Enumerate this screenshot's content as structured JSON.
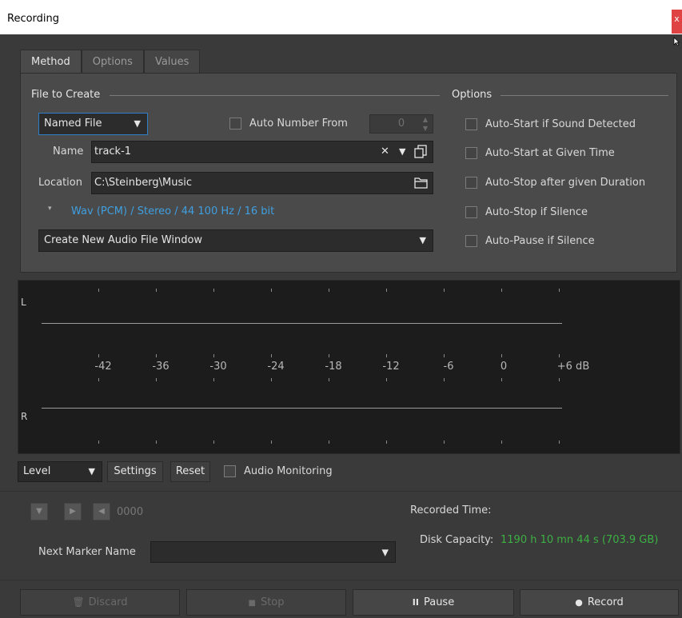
{
  "window": {
    "title": "Recording",
    "close_label": "x"
  },
  "tabs": [
    {
      "label": "Method",
      "active": true
    },
    {
      "label": "Options",
      "active": false
    },
    {
      "label": "Values",
      "active": false
    }
  ],
  "file_to_create": {
    "section_label": "File to Create",
    "mode_dropdown": "Named File",
    "auto_number_label": "Auto Number From",
    "auto_number_value": "0",
    "name_label": "Name",
    "name_value": "track-1",
    "location_label": "Location",
    "location_value": "C:\\Steinberg\\Music",
    "format_text": "Wav (PCM) / Stereo / 44 100 Hz / 16 bit",
    "window_dropdown": "Create New Audio File Window"
  },
  "options": {
    "section_label": "Options",
    "items": [
      "Auto-Start if Sound Detected",
      "Auto-Start at Given Time",
      "Auto-Stop after given Duration",
      "Auto-Stop if Silence",
      "Auto-Pause if Silence"
    ]
  },
  "meter": {
    "left_channel": "L",
    "right_channel": "R",
    "scale": [
      "-42",
      "-36",
      "-30",
      "-24",
      "-18",
      "-12",
      "-6",
      "0",
      "+6 dB"
    ]
  },
  "meter_controls": {
    "mode_dropdown": "Level",
    "settings_label": "Settings",
    "reset_label": "Reset",
    "monitoring_label": "Audio Monitoring"
  },
  "markers": {
    "counter": "0000",
    "next_marker_label": "Next Marker Name",
    "next_marker_value": ""
  },
  "status": {
    "recorded_time_label": "Recorded Time:",
    "disk_capacity_label": "Disk Capacity:",
    "disk_capacity_value": "1190 h 10 mn 44 s (703.9 GB)",
    "disk_capacity_color": "#3cb043"
  },
  "actions": {
    "discard_label": "Discard",
    "stop_label": "Stop",
    "pause_label": "Pause",
    "record_label": "Record"
  },
  "icons": [
    "close-icon",
    "dropdown-arrow-icon",
    "clear-icon",
    "file-copy-icon",
    "folder-icon",
    "expand-icon",
    "trash-icon",
    "stop-icon",
    "pause-icon",
    "record-icon",
    "prev-marker-icon",
    "play-icon",
    "next-marker-icon",
    "cursor-icon"
  ]
}
